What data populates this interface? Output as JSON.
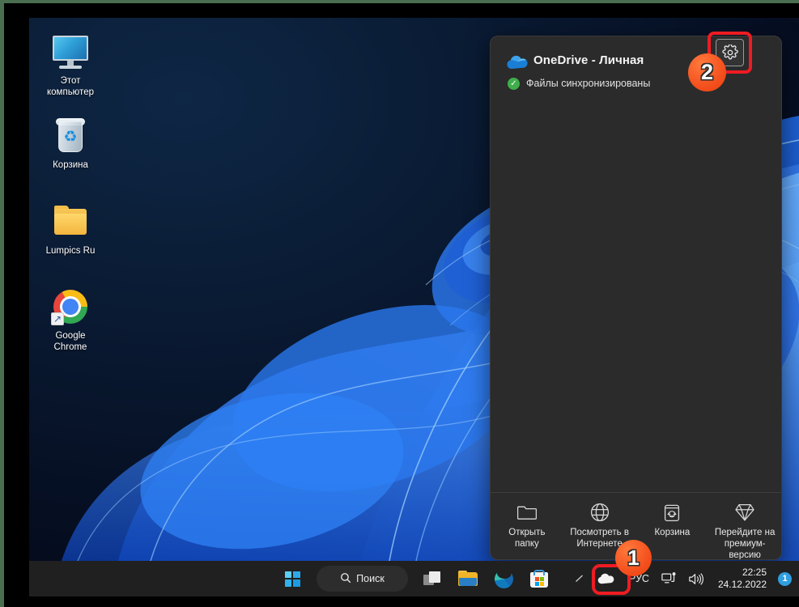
{
  "desktop": {
    "icons": [
      {
        "name": "this-pc",
        "label": "Этот\nкомпьютер",
        "label_line1": "Этот",
        "label_line2": "компьютер",
        "icon": "monitor-icon"
      },
      {
        "name": "recycle-bin",
        "label": "Корзина",
        "label_line1": "Корзина",
        "label_line2": "",
        "icon": "recycle-bin-icon"
      },
      {
        "name": "lumpics-folder",
        "label": "Lumpics Ru",
        "label_line1": "Lumpics Ru",
        "label_line2": "",
        "icon": "folder-icon"
      },
      {
        "name": "google-chrome",
        "label": "Google Chrome",
        "label_line1": "Google",
        "label_line2": "Chrome",
        "icon": "chrome-icon"
      }
    ]
  },
  "onedrive_panel": {
    "title": "OneDrive - Личная",
    "status_text": "Файлы синхронизированы",
    "status_icon": "green-check-icon",
    "cloud_icon": "onedrive-cloud-icon",
    "settings_button": {
      "icon": "gear-icon",
      "highlight_color": "#ee1c23",
      "marker": "2"
    },
    "actions": [
      {
        "name": "open-folder",
        "icon": "folder-outline-icon",
        "line1": "Открыть",
        "line2": "папку",
        "line3": ""
      },
      {
        "name": "view-online",
        "icon": "globe-icon",
        "line1": "Посмотреть в",
        "line2": "Интернете",
        "line3": ""
      },
      {
        "name": "recycle-bin",
        "icon": "trash-recycle-icon",
        "line1": "Корзина",
        "line2": "",
        "line3": ""
      },
      {
        "name": "go-premium",
        "icon": "diamond-icon",
        "line1": "Перейдите на",
        "line2": "премиум-",
        "line3": "версию"
      }
    ]
  },
  "taskbar": {
    "start_button_icon": "windows-logo-icon",
    "search": {
      "icon": "search-icon",
      "label": "Поиск"
    },
    "buttons": [
      {
        "name": "task-view",
        "icon": "task-view-icon"
      },
      {
        "name": "file-explorer",
        "icon": "file-explorer-icon"
      },
      {
        "name": "microsoft-edge",
        "icon": "edge-icon"
      },
      {
        "name": "microsoft-store",
        "icon": "store-icon"
      }
    ],
    "tray": {
      "overflow_icon": "chevron-up-icon",
      "onedrive_icon": "onedrive-tray-cloud-icon",
      "onedrive_marker": "1",
      "onedrive_highlight_color": "#ee1c23",
      "language": "РУС",
      "network_icon": "network-icon",
      "volume_icon": "volume-icon",
      "time": "22:25",
      "date": "24.12.2022",
      "notification_count": "1"
    }
  },
  "colors": {
    "accent_blue": "#2f9fe0",
    "marker_orange": "#f4511e",
    "highlight_red": "#ee1c23",
    "panel_bg": "#2b2b2b",
    "taskbar_bg": "#202020",
    "frame_green": "#4a6e50"
  }
}
